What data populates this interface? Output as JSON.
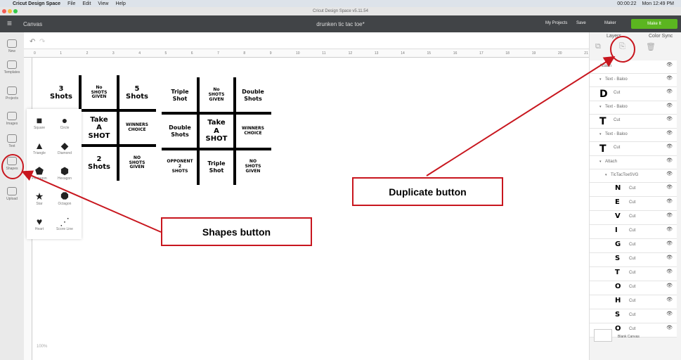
{
  "menubar": {
    "app": "Cricut Design Space",
    "items": [
      "File",
      "Edit",
      "View",
      "Help"
    ],
    "clock": "00:00:22",
    "time": "Mon 12:49 PM"
  },
  "window_title": "Cricut Design Space v5.11.54",
  "header": {
    "section": "Canvas",
    "project": "drunken tic tac toe*",
    "my_projects": "My Projects",
    "save": "Save",
    "machine": "Maker",
    "make": "Make It"
  },
  "sidebar": [
    "New",
    "Templates",
    "Projects",
    "Images",
    "Text",
    "Shapes",
    "Upload"
  ],
  "ruler": [
    "0",
    "1",
    "2",
    "3",
    "4",
    "5",
    "6",
    "7",
    "8",
    "9",
    "10",
    "11",
    "12",
    "13",
    "14",
    "15",
    "16",
    "17",
    "18",
    "19",
    "20",
    "21"
  ],
  "board1": [
    "3\nShots",
    "No\nSHOTS\nGIVEN",
    "5\nShots",
    "",
    "Take\nA\nSHOT",
    "WINNERS\nCHOICE",
    "",
    "2\nShots",
    "NO\nSHOTS\nGIVEN"
  ],
  "board2": [
    "Triple\nShot",
    "No\nSHOTS\nGIVEN",
    "Double\nShots",
    "Double\nShots",
    "Take\nA\nSHOT",
    "WINNERS\nCHOICE",
    "OPPONENT\n2\nSHOTS",
    "Triple\nShot",
    "NO\nSHOTS\nGIVEN"
  ],
  "shapes": [
    {
      "g": "■",
      "l": "Square"
    },
    {
      "g": "●",
      "l": "Circle"
    },
    {
      "g": "▲",
      "l": "Triangle"
    },
    {
      "g": "◆",
      "l": "Diamond"
    },
    {
      "g": "⬟",
      "l": "Pentagon"
    },
    {
      "g": "⬢",
      "l": "Hexagon"
    },
    {
      "g": "★",
      "l": "Star"
    },
    {
      "g": "⯃",
      "l": "Octagon"
    },
    {
      "g": "♥",
      "l": "Heart"
    },
    {
      "g": "⋰",
      "l": "Score Line"
    }
  ],
  "panel": {
    "tabs": [
      "Layers",
      "Color Sync"
    ],
    "actions": [
      "Group",
      "Duplicate",
      "Delete"
    ],
    "blank": "Blank Canvas",
    "layers": [
      {
        "t": "Attach",
        "lvl": 0
      },
      {
        "t": "Text - Baloo",
        "lvl": 1
      },
      {
        "big": "D",
        "t": "Cut",
        "lvl": 1
      },
      {
        "t": "Text - Baloo",
        "lvl": 1
      },
      {
        "big": "T",
        "t": "Cut",
        "lvl": 1
      },
      {
        "t": "Text - Baloo",
        "lvl": 1
      },
      {
        "big": "T",
        "t": "Cut",
        "lvl": 1
      },
      {
        "t": "Attach",
        "lvl": 1
      },
      {
        "t": "TicTacToeSVG",
        "lvl": 2
      },
      {
        "big": "N",
        "t": "Cut",
        "lvl": 3
      },
      {
        "big": "E",
        "t": "Cut",
        "lvl": 3
      },
      {
        "big": "V",
        "t": "Cut",
        "lvl": 3
      },
      {
        "big": "I",
        "t": "Cut",
        "lvl": 3
      },
      {
        "big": "G",
        "t": "Cut",
        "lvl": 3
      },
      {
        "big": "S",
        "t": "Cut",
        "lvl": 3
      },
      {
        "big": "T",
        "t": "Cut",
        "lvl": 3
      },
      {
        "big": "O",
        "t": "Cut",
        "lvl": 3
      },
      {
        "big": "H",
        "t": "Cut",
        "lvl": 3
      },
      {
        "big": "S",
        "t": "Cut",
        "lvl": 3
      },
      {
        "big": "O",
        "t": "Cut",
        "lvl": 3
      }
    ]
  },
  "zoom": "100%",
  "annotations": {
    "shapes": "Shapes button",
    "duplicate": "Duplicate button",
    "color": "#c8161e"
  }
}
